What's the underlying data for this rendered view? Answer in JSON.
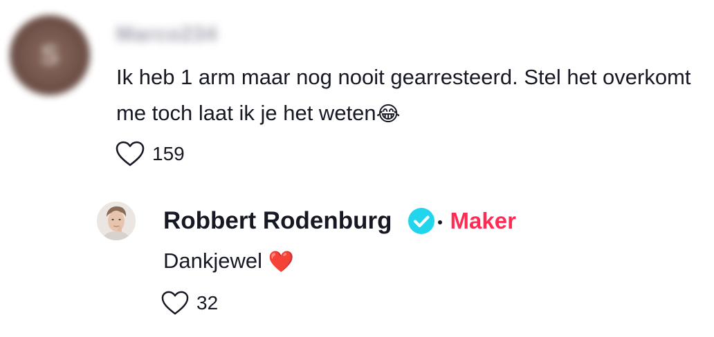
{
  "comment": {
    "author_username": "Marco234",
    "author_initial": "S",
    "text": "Ik heb 1 arm maar nog nooit gearresteerd. Stel het overkomt me toch laat ik je het weten",
    "emoji": "😂",
    "like_count": "159"
  },
  "reply": {
    "author_name": "Robbert Rodenburg",
    "creator_label": "Maker",
    "text": "Dankjewel",
    "emoji": "❤️",
    "like_count": "32"
  },
  "colors": {
    "accent": "#fe2c55",
    "verified": "#20d5ec",
    "text": "#161823"
  },
  "icons": {
    "like": "heart-outline-icon",
    "verified": "verified-badge-icon"
  }
}
